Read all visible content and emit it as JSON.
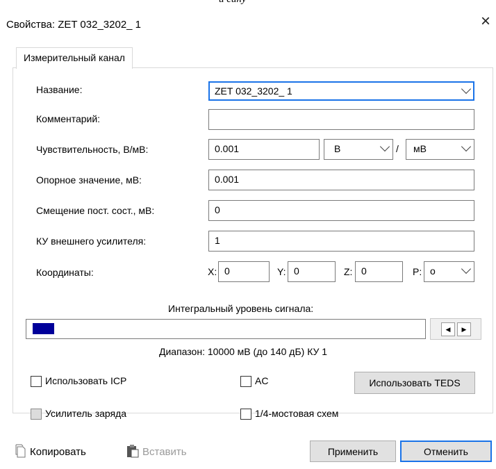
{
  "window": {
    "title": "Свойства: ZET 032_3202_ 1",
    "close_glyph": "×"
  },
  "top_crop_text": "и сину",
  "tab": {
    "label": "Измерительный канал"
  },
  "fields": {
    "name": {
      "label": "Название:",
      "value": "ZET 032_3202_ 1"
    },
    "comment": {
      "label": "Комментарий:",
      "value": ""
    },
    "sensitivity": {
      "label": "Чувствительность, В/мВ:",
      "value": "0.001",
      "unit1": "В",
      "separator": "/",
      "unit2": "мВ"
    },
    "reference": {
      "label": "Опорное значение, мВ:",
      "value": "0.001"
    },
    "offset": {
      "label": "Смещение пост. сост., мВ:",
      "value": "0"
    },
    "ext_gain": {
      "label": "КУ внешнего усилителя:",
      "value": "1"
    },
    "coords": {
      "label": "Координаты:",
      "x_label": "X:",
      "x": "0",
      "y_label": "Y:",
      "y": "0",
      "z_label": "Z:",
      "z": "0",
      "p_label": "P:",
      "p": "о"
    }
  },
  "signal": {
    "title": "Интегральный уровень сигнала:",
    "level_fraction": 0.055,
    "range_text": "Диапазон: 10000 мВ (до 140 дБ) КУ 1",
    "fill_color": "#00009a"
  },
  "checkboxes": {
    "icp": {
      "label": "Использовать ICP",
      "checked": false
    },
    "ac": {
      "label": "AC",
      "checked": false
    },
    "charge_amp": {
      "label": "Усилитель заряда",
      "checked": false,
      "disabled": true
    },
    "quarter_bridge": {
      "label": "1/4-мостовая схем",
      "checked": false
    }
  },
  "buttons": {
    "teds": "Использовать TEDS",
    "copy": "Копировать",
    "paste": "Вставить",
    "apply": "Применить",
    "cancel": "Отменить"
  },
  "colors": {
    "accent": "#1a73e8",
    "level": "#00009a"
  }
}
